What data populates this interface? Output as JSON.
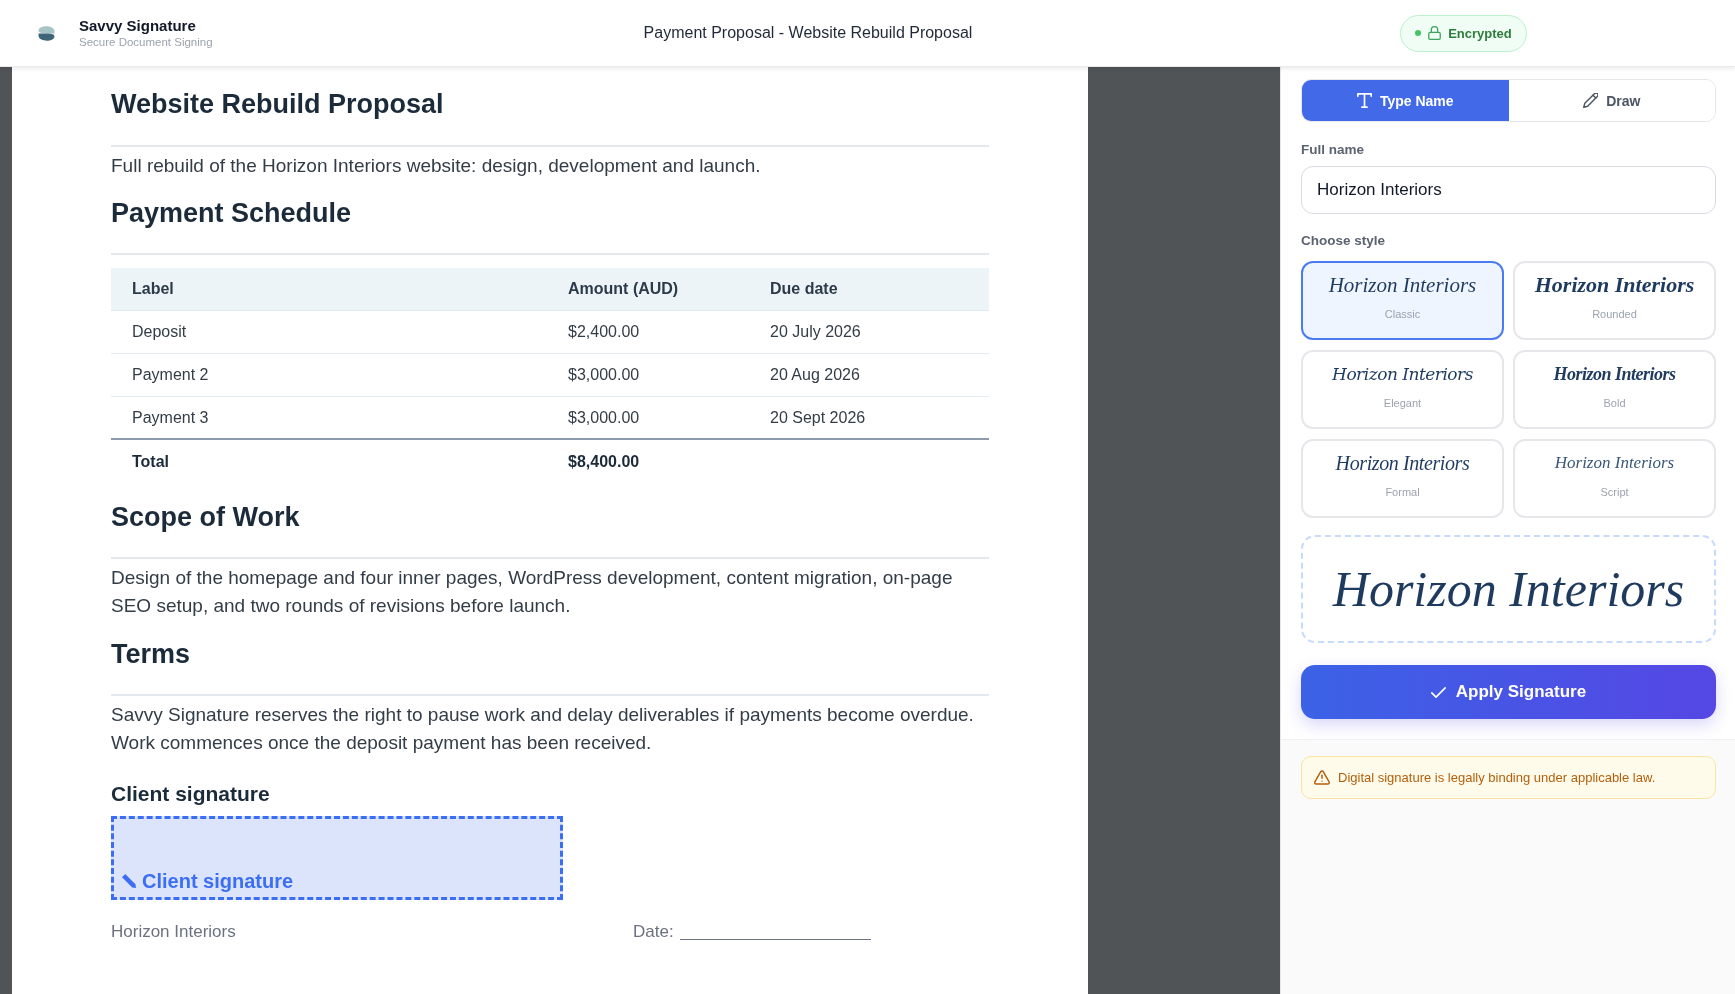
{
  "header": {
    "brand": "Savvy Signature",
    "tagline": "Secure Document Signing",
    "title": "Payment Proposal - Website Rebuild Proposal",
    "badge": "Encrypted"
  },
  "document": {
    "title": "Website Rebuild Proposal",
    "intro": "Full rebuild of the Horizon Interiors website: design, development and launch.",
    "sections": [
      {
        "heading": "Payment Schedule",
        "kind": "table",
        "table": {
          "columns": [
            "Label",
            "Amount (AUD)",
            "Due date"
          ],
          "rows": [
            [
              "Deposit",
              "$2,400.00",
              "20 July 2026"
            ],
            [
              "Payment 2",
              "$3,000.00",
              "20 Aug 2026"
            ],
            [
              "Payment 3",
              "$3,000.00",
              "20 Sept 2026"
            ]
          ],
          "total": {
            "label": "Total",
            "amount": "$8,400.00"
          }
        }
      },
      {
        "heading": "Scope of Work",
        "kind": "text",
        "text": "Design of the homepage and four inner pages, WordPress development, content migration, on-page SEO setup, and two rounds of revisions before launch."
      },
      {
        "heading": "Terms",
        "kind": "text",
        "text": "Savvy Signature reserves the right to pause work and delay deliverables if payments become overdue. Work commences once the deposit payment has been received."
      }
    ],
    "signature": {
      "heading": "Client signature",
      "prompt": "Client signature",
      "signer": "Horizon Interiors",
      "date_label": "Date:"
    }
  },
  "panel": {
    "tabs": [
      {
        "label": "Type Name",
        "selected": true
      },
      {
        "label": "Draw",
        "selected": false
      }
    ],
    "full_name": {
      "label": "Full name",
      "value": "Horizon Interiors"
    },
    "style_label": "Choose style",
    "styles": [
      {
        "sample": "Horizon Interiors",
        "name": "Classic",
        "kind": "classic",
        "selected": true
      },
      {
        "sample": "Horizon Interiors",
        "name": "Rounded",
        "kind": "rounded",
        "selected": false
      },
      {
        "sample": "Horizon Interiors",
        "name": "Elegant",
        "kind": "elegant",
        "selected": false
      },
      {
        "sample": "Horizon Interiors",
        "name": "Bold",
        "kind": "bold",
        "selected": false
      },
      {
        "sample": "Horizon Interiors",
        "name": "Formal",
        "kind": "formal",
        "selected": false
      },
      {
        "sample": "Horizon Interiors",
        "name": "Script",
        "kind": "script",
        "selected": false
      }
    ],
    "preview": "Horizon Interiors",
    "apply_button": "Apply Signature",
    "notice": "Digital signature is legally binding under applicable law."
  }
}
